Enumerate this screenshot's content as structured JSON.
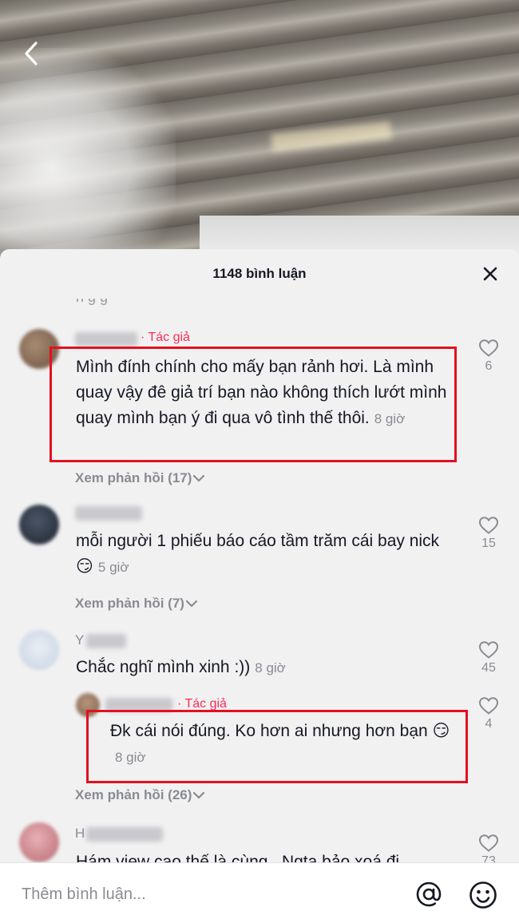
{
  "sheet": {
    "title": "1148 bình luận",
    "cut_top_text": "n   g   g"
  },
  "comments": [
    {
      "author_tag": "· Tác giả",
      "text": "Mình đính chính cho mấy bạn rảnh hơi. Là mình quay vậy đê giả trí bạn nào không thích lướt mình quay mình bạn ý đi qua vô tình thế thôi.",
      "time": "8 giờ",
      "likes": "6",
      "replies": "Xem phản hồi (17)",
      "highlighted": true
    },
    {
      "text": "mỗi người 1 phiếu báo cáo tầm trăm cái bay nick",
      "emoji": "😏",
      "time": "5 giờ",
      "likes": "15",
      "replies": "Xem phản hồi (7)"
    },
    {
      "name_initial": "Y",
      "text": "Chắc nghĩ mình xinh :))",
      "time": "8 giờ",
      "likes": "45"
    },
    {
      "author_tag": "· Tác giả",
      "text": "Đk cái nói đúng. Ko hơn ai nhưng hơn bạn",
      "emoji": "😏",
      "time": "8 giờ",
      "likes": "4",
      "replies": "Xem phản hồi (26)",
      "highlighted": true,
      "is_reply": true
    },
    {
      "name_initial": "H",
      "text": "Hám view cao thế là cùng . Ngta bảo xoá đi",
      "likes": "73"
    }
  ],
  "input": {
    "placeholder": "Thêm bình luận..."
  },
  "colors": {
    "accent_author": "#fe2c55",
    "highlight_box": "#e3101f",
    "sheet_bg": "#f1f1f2",
    "muted_text": "#8a8b91"
  },
  "icons": {
    "back": "chevron-left-icon",
    "close": "close-icon",
    "like": "heart-outline-icon",
    "replies_chevron": "chevron-down-icon",
    "mention": "at-sign-icon",
    "emoji": "smiley-icon"
  }
}
